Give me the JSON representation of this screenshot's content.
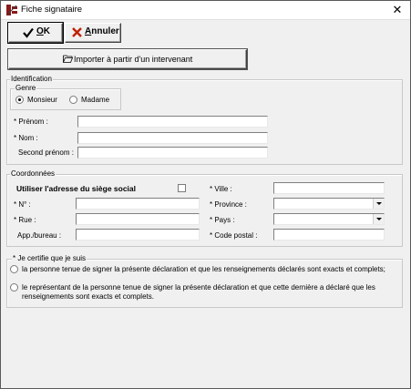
{
  "window": {
    "title": "Fiche signataire",
    "close_glyph": "✕"
  },
  "toolbar": {
    "ok_label": "OK",
    "cancel_label": "Annuler",
    "import_label": "Importer à partir d'un intervenant"
  },
  "identification": {
    "group_label": "Identification",
    "genre_label": "Genre",
    "genre_options": [
      "Monsieur",
      "Madame"
    ],
    "genre_selected": "Monsieur",
    "prenom_label": "* Prénom :",
    "nom_label": "* Nom :",
    "second_prenom_label": "Second prénom :",
    "prenom_value": "",
    "nom_value": "",
    "second_prenom_value": ""
  },
  "coordonnees": {
    "group_label": "Coordonnées",
    "use_siege_label": "Utiliser l'adresse du siège social",
    "use_siege_checked": false,
    "no_label": "* N° :",
    "rue_label": "* Rue :",
    "app_label": "App./bureau :",
    "ville_label": "* Ville :",
    "province_label": "* Province :",
    "pays_label": "* Pays :",
    "code_postal_label": "* Code postal :",
    "no_value": "",
    "rue_value": "",
    "app_value": "",
    "ville_value": "",
    "province_value": "",
    "pays_value": "",
    "code_postal_value": ""
  },
  "certification": {
    "group_label": "* Je certifie que je suis",
    "option1": "la personne tenue de signer la présente déclaration et que les renseignements déclarés sont exacts et complets;",
    "option2_line1": "le représentant de la personne tenue de signer la présente déclaration et que cette dernière a déclaré que les",
    "option2_line2": "renseignements sont exacts et complets."
  },
  "icons": {
    "app": "signature-app-icon",
    "ok": "checkmark-icon",
    "cancel": "x-icon",
    "import": "folder-open-icon"
  },
  "colors": {
    "ok_check": "#000000",
    "cancel_x": "#c02000",
    "app_icon": "#8b1a1a"
  }
}
